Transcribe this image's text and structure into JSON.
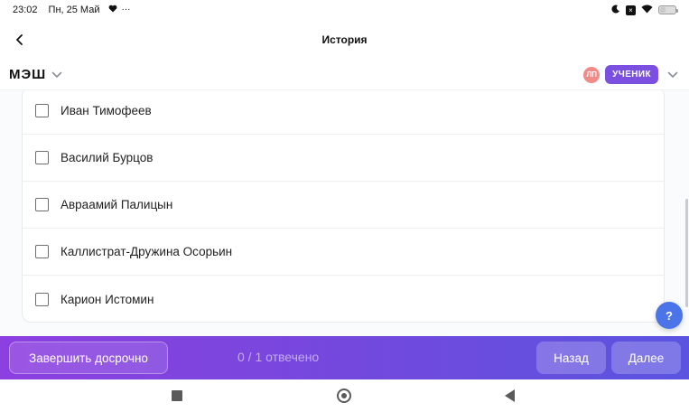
{
  "status_bar": {
    "time": "23:02",
    "date": "Пн, 25 Май",
    "more": "···",
    "battery_level": 0.35
  },
  "title_bar": {
    "title": "История"
  },
  "app_bar": {
    "logo": "МЭШ",
    "avatar_initials": "ЛП",
    "role": "УЧЕНИК",
    "avatar_color": "#f08b87",
    "role_color": "#7b4fe0"
  },
  "options": [
    {
      "label": "Иван Тимофеев",
      "checked": false
    },
    {
      "label": "Василий Бурцов",
      "checked": false
    },
    {
      "label": "Авраамий Палицын",
      "checked": false
    },
    {
      "label": "Каллистрат-Дружина Осорьин",
      "checked": false
    },
    {
      "label": "Карион Истомин",
      "checked": false
    }
  ],
  "help": {
    "label": "?",
    "color": "#4a74e8"
  },
  "footer": {
    "finish_label": "Завершить досрочно",
    "answered_text": "0 / 1 отвечено",
    "back_label": "Назад",
    "next_label": "Далее",
    "gradient_start": "#8d3fe0",
    "gradient_end": "#5a54e0"
  }
}
